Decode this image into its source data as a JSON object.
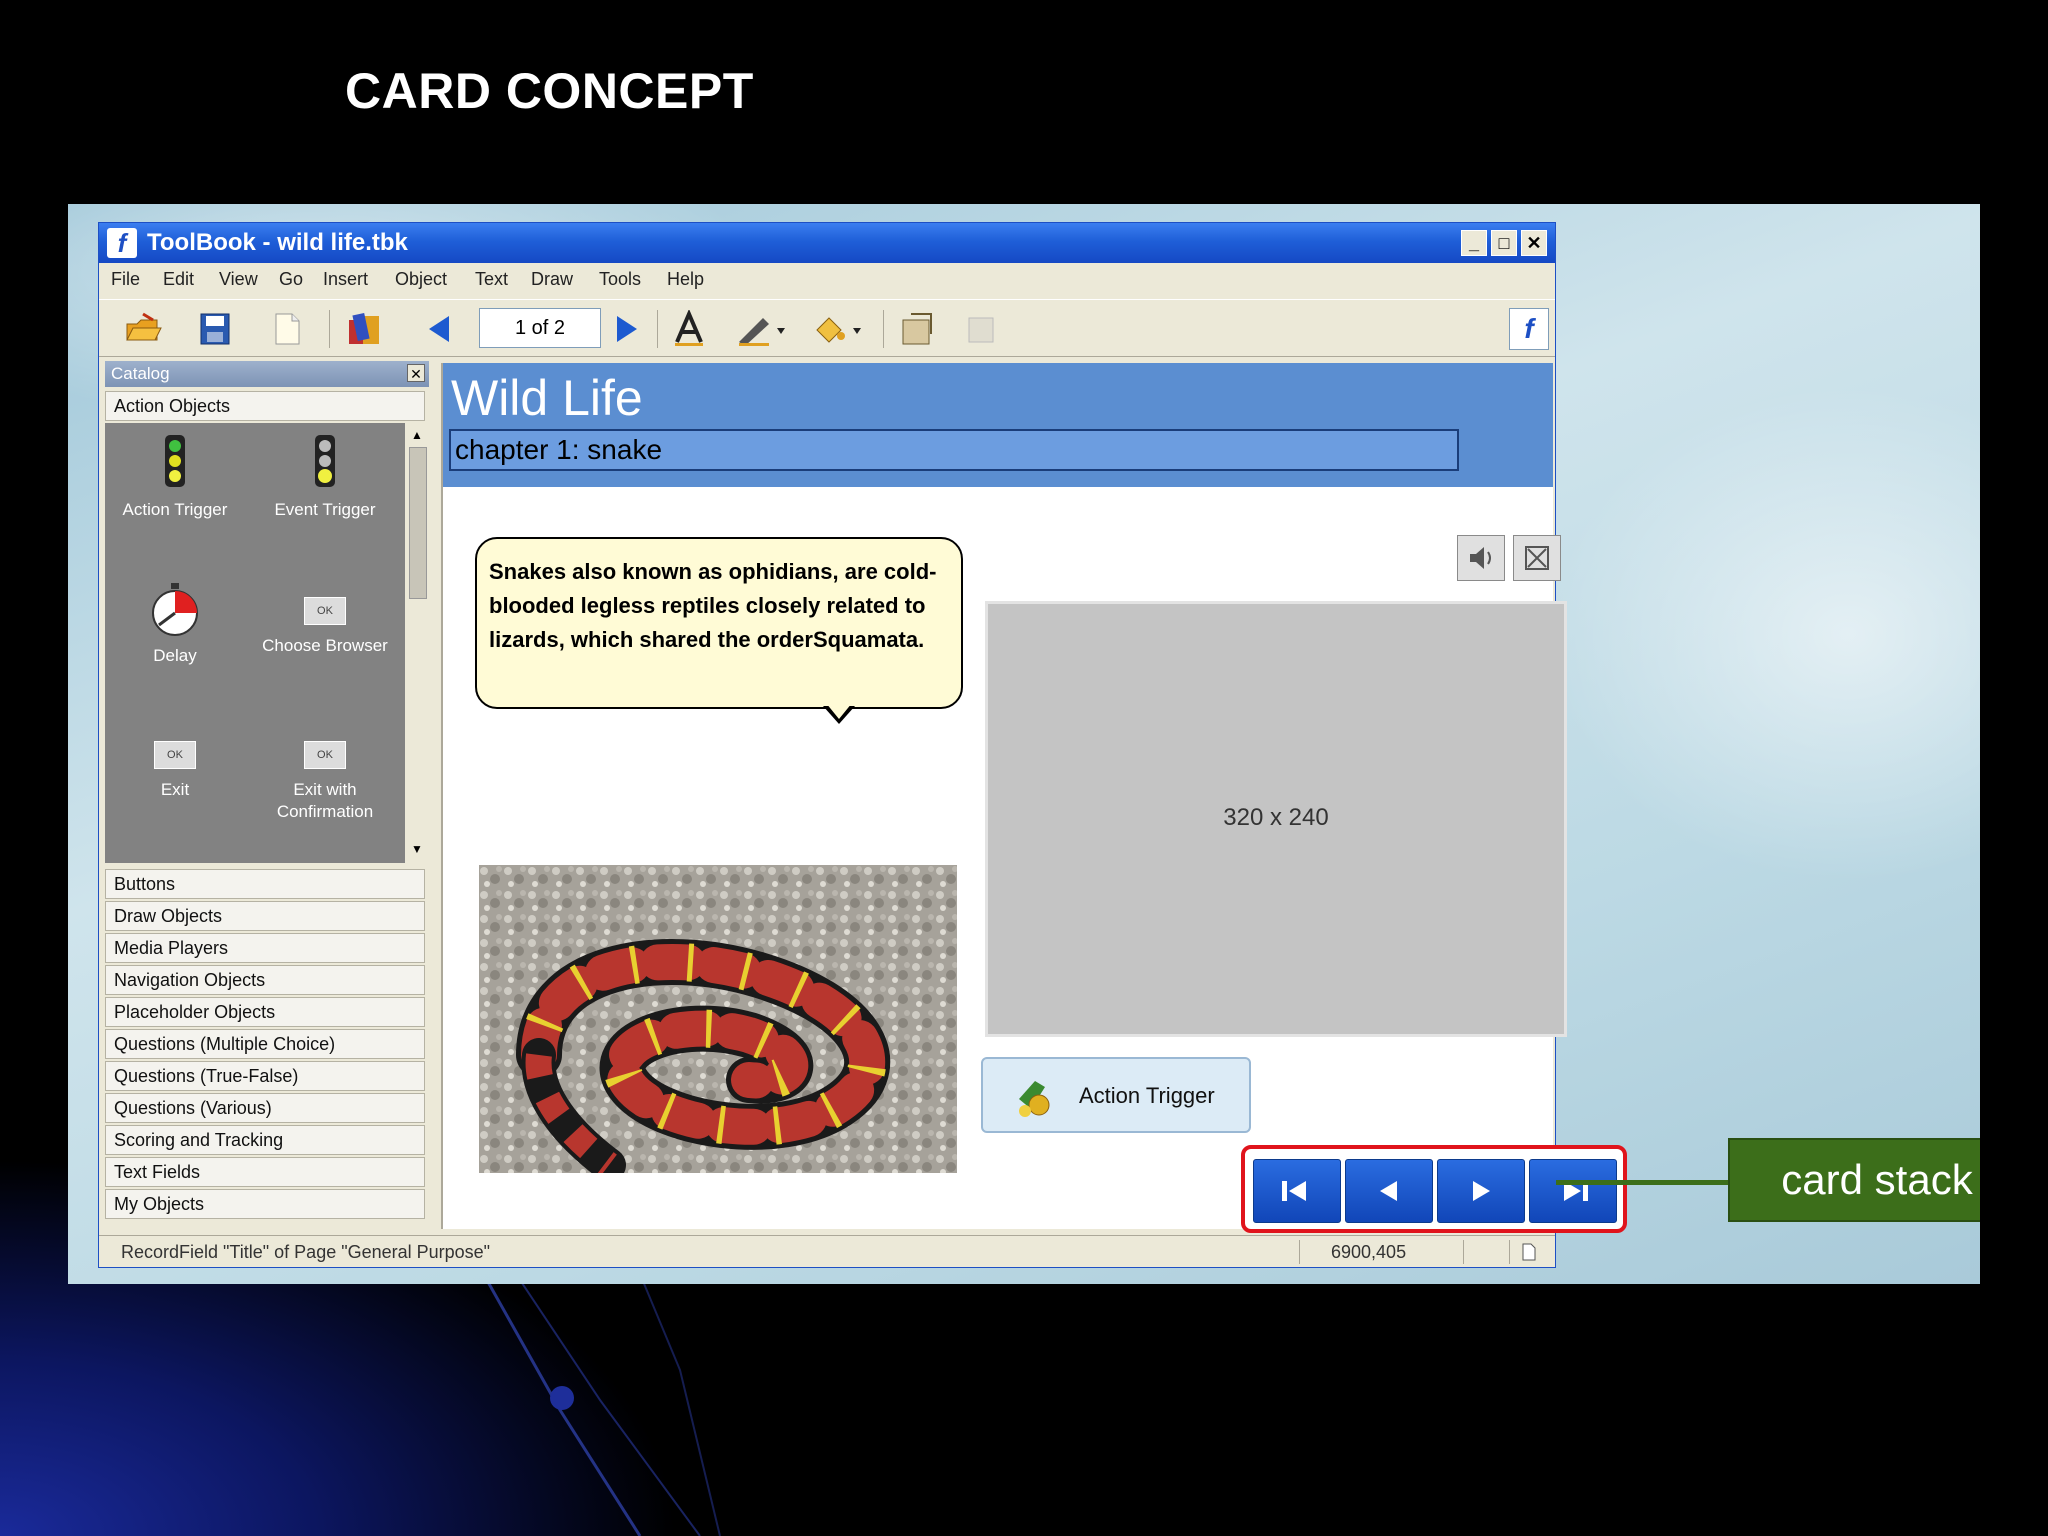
{
  "slide": {
    "title": "CARD CONCEPT"
  },
  "window": {
    "title": "ToolBook - wild life.tbk",
    "controls": {
      "minimize": "_",
      "maximize": "□",
      "close": "✕"
    },
    "menu": [
      "File",
      "Edit",
      "View",
      "Go",
      "Insert",
      "Object",
      "Text",
      "Draw",
      "Tools",
      "Help"
    ],
    "toolbar": {
      "page_indicator": "1 of 2"
    },
    "status": {
      "text": "RecordField \"Title\" of Page \"General Purpose\"",
      "coords": "6900,405"
    }
  },
  "catalog": {
    "title": "Catalog",
    "active_section": "Action Objects",
    "items": [
      {
        "label": "Action Trigger"
      },
      {
        "label": "Event Trigger"
      },
      {
        "label": "Delay"
      },
      {
        "label": "Choose Browser"
      },
      {
        "label": "Exit"
      },
      {
        "label": "Exit with Confirmation"
      }
    ],
    "ok_label": "OK",
    "sections": [
      "Buttons",
      "Draw Objects",
      "Media Players",
      "Navigation Objects",
      "Placeholder Objects",
      "Questions (Multiple Choice)",
      "Questions (True-False)",
      "Questions (Various)",
      "Scoring and Tracking",
      "Text Fields",
      "My Objects"
    ]
  },
  "page": {
    "title": "Wild Life",
    "chapter": "chapter 1: snake",
    "bubble_text": "Snakes also known as ophidians, are cold-blooded legless reptiles closely related to lizards, which shared the orderSquamata.",
    "media_placeholder": "320 x 240",
    "action_trigger_label": "Action Trigger"
  },
  "callout": {
    "label": "card stack",
    "color": "#3c6e1a"
  },
  "colors": {
    "titlebar": "#1f5fd8",
    "header": "#5b8ed1",
    "nav_highlight": "#e0141c",
    "nav_button": "#1d5ad0"
  }
}
